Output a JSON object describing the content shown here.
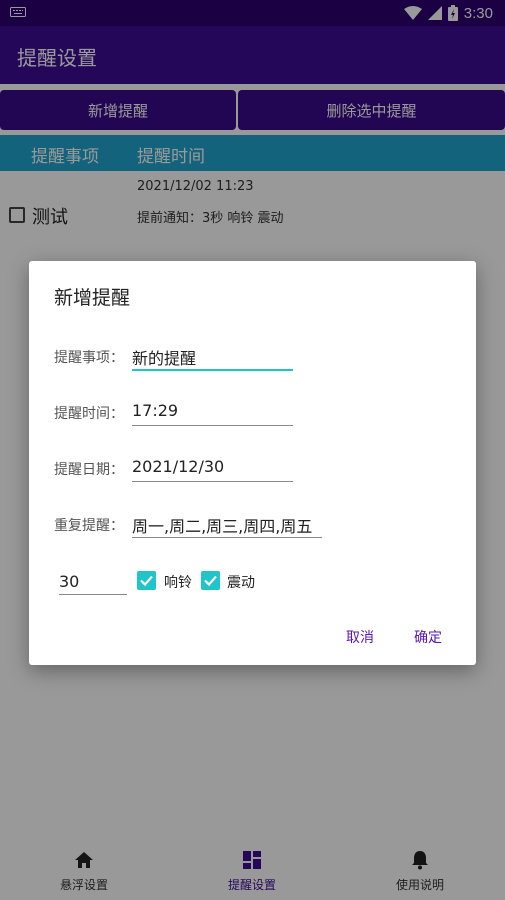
{
  "status_bar": {
    "time": "3:30"
  },
  "app_bar": {
    "title": "提醒设置"
  },
  "actions": {
    "add_label": "新增提醒",
    "delete_label": "删除选中提醒"
  },
  "table_header": {
    "col_item": "提醒事项",
    "col_time": "提醒时间"
  },
  "reminders": [
    {
      "name": "测试",
      "datetime": "2021/12/02  11:23",
      "note": "提前通知：3秒  响铃  震动",
      "checked": false
    }
  ],
  "dialog": {
    "title": "新增提醒",
    "item_label": "提醒事项：",
    "item_value": "新的提醒",
    "time_label": "提醒时间：",
    "time_value": "17:29",
    "date_label": "提醒日期：",
    "date_value": "2021/12/30",
    "repeat_label": "重复提醒：",
    "repeat_value": "周一,周二,周三,周四,周五",
    "advance_value": "30",
    "ring_label": "响铃",
    "ring_checked": true,
    "vibrate_label": "震动",
    "vibrate_checked": true,
    "cancel_label": "取消",
    "confirm_label": "确定"
  },
  "bottom_nav": [
    {
      "label": "悬浮设置",
      "icon": "home-icon",
      "active": false
    },
    {
      "label": "提醒设置",
      "icon": "grid-icon",
      "active": true
    },
    {
      "label": "使用说明",
      "icon": "bell-icon",
      "active": false
    }
  ],
  "colors": {
    "primary": "#3f0d96",
    "status_bar": "#2d0070",
    "header": "#21a6cf",
    "accent": "#20c5c9",
    "dialog_button": "#5b14b8"
  }
}
